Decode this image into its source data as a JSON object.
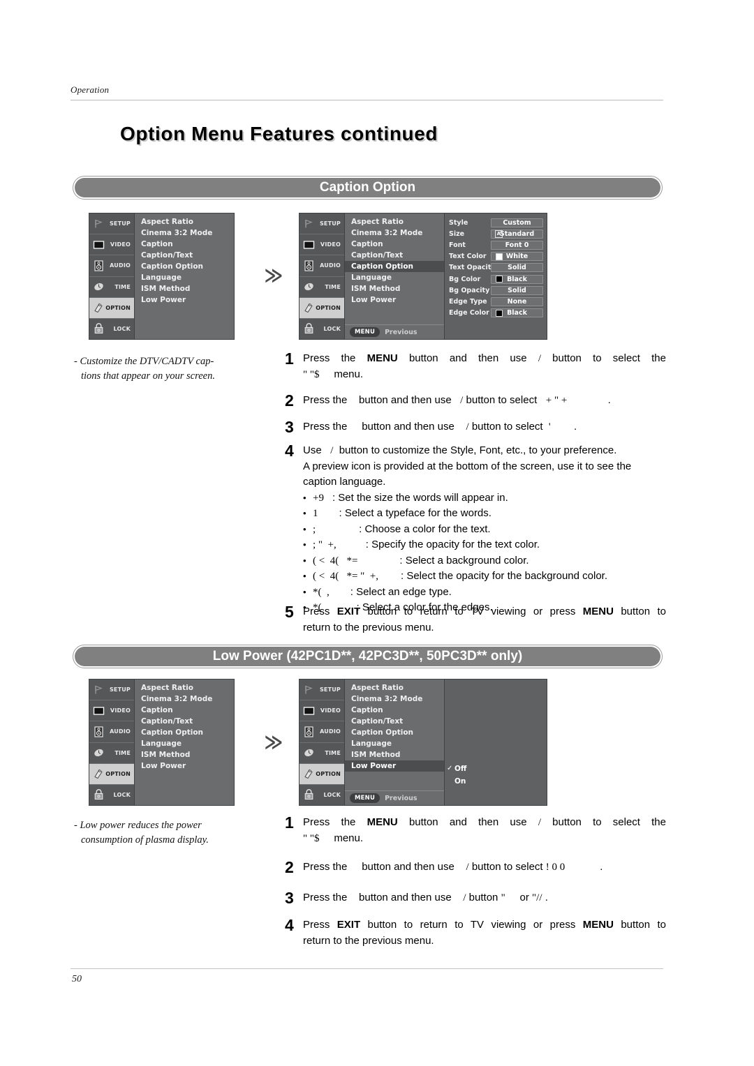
{
  "header": {
    "running_head": "Operation",
    "title": "Option Menu Features continued"
  },
  "sections": [
    {
      "id": "caption",
      "pill_label": "Caption Option"
    },
    {
      "id": "lowpower",
      "pill_label": "Low Power (42PC1D**, 42PC3D**, 50PC3D** only)"
    }
  ],
  "osd": {
    "sidebar": [
      {
        "label": "SETUP",
        "icon": "flag-icon",
        "active": false
      },
      {
        "label": "VIDEO",
        "icon": "screen-icon",
        "active": false
      },
      {
        "label": "AUDIO",
        "icon": "speaker-icon",
        "active": false
      },
      {
        "label": "TIME",
        "icon": "clock-icon",
        "active": false
      },
      {
        "label": "OPTION",
        "icon": "tag-icon",
        "active": true
      },
      {
        "label": "LOCK",
        "icon": "padlock-icon",
        "active": false
      }
    ],
    "menu_items": [
      "Aspect Ratio",
      "Cinema 3:2 Mode",
      "Caption",
      "Caption/Text",
      "Caption Option",
      "Language",
      "ISM Method",
      "Low Power"
    ],
    "selected_caption_option": "Caption Option",
    "selected_low_power": "Low Power",
    "footer": {
      "menu_chip": "MENU",
      "previous_label": "Previous"
    },
    "caption_detail": [
      {
        "label": "Style",
        "value": "Custom",
        "marker": "none"
      },
      {
        "label": "Size",
        "value": "Standard",
        "marker": "sizeA"
      },
      {
        "label": "Font",
        "value": "Font  0",
        "marker": "none"
      },
      {
        "label": "Text Color",
        "value": "White",
        "marker": "swatch",
        "swatch": "#ffffff"
      },
      {
        "label": "Text Opacity",
        "value": "Solid",
        "marker": "none"
      },
      {
        "label": "Bg Color",
        "value": "Black",
        "marker": "swatch",
        "swatch": "#000000"
      },
      {
        "label": "Bg Opacity",
        "value": "Solid",
        "marker": "none"
      },
      {
        "label": "Edge Type",
        "value": "None",
        "marker": "none"
      },
      {
        "label": "Edge Color",
        "value": "Black",
        "marker": "swatch",
        "swatch": "#000000"
      }
    ],
    "size_glyph": "A",
    "low_power_options": [
      {
        "label": "Off",
        "checked": true,
        "check": "✓"
      },
      {
        "label": "On",
        "checked": false,
        "check": ""
      }
    ],
    "arrow_glyph": "≫"
  },
  "caption_section": {
    "note_line1": "- Customize the DTV/CADTV cap-",
    "note_line2": "tions that appear on your screen.",
    "steps": [
      {
        "num": "1",
        "line1_a": "Press  the ",
        "line1_bold": "MENU",
        "line1_b": " button  and  then  use ",
        "line1_glyph": "/",
        "line1_c": " button  to  select  the",
        "line2_glyph": "\" \"$",
        "line2_b": "menu."
      },
      {
        "num": "2",
        "text_a": "Press the ",
        "glyph_1": "",
        "text_b": "button and then use ",
        "glyph_2": "/",
        "text_c": " button to select ",
        "glyph_3": "+  \" +",
        "text_d": "."
      },
      {
        "num": "3",
        "text_a": "Press the ",
        "glyph_1": "",
        "text_b": "button and then use ",
        "glyph_2": "/",
        "text_c": " button to select ",
        "glyph_3": "'",
        "text_d": "."
      },
      {
        "num": "4",
        "line1_a": "Use ",
        "line1_glyph": "/",
        "line1_b": " button to customize the Style, Font, etc., to your preference.",
        "line2": "A preview icon is provided at the bottom of the screen, use it to see the",
        "line3": "caption language.",
        "bullets": [
          {
            "tag": "+9",
            "desc": ": Set the size the words will appear in."
          },
          {
            "tag": "1",
            "desc": ": Select a typeface for the words."
          },
          {
            "tag": ";",
            "desc": ": Choose a color for the text."
          },
          {
            "tag": "; \"  +,",
            "desc": ": Specify the opacity for the text color."
          },
          {
            "tag": "( <  4(   *=",
            "desc": ": Select a background color."
          },
          {
            "tag": "( <  4(   *= \"  +,",
            "desc": ": Select the opacity for the background color."
          },
          {
            "tag": "*(  ,",
            "desc": ": Select an edge type."
          },
          {
            "tag": "*(",
            "desc": ": Select a color for the edges."
          }
        ]
      },
      {
        "num": "5",
        "line1_a": "Press ",
        "line1_bold1": "EXIT",
        "line1_b": " button to return to TV viewing or press ",
        "line1_bold2": "MENU",
        "line1_c": " button to",
        "line2": "return to the previous menu."
      }
    ]
  },
  "lowpower_section": {
    "note_line1": "- Low power reduces the power",
    "note_line2": "consumption of plasma display.",
    "steps": [
      {
        "num": "1",
        "line1_a": "Press  the ",
        "line1_bold": "MENU",
        "line1_b": " button  and  then  use ",
        "line1_glyph": "/",
        "line1_c": " button  to  select  the",
        "line2_glyph": "\" \"$",
        "line2_b": "menu."
      },
      {
        "num": "2",
        "text_a": "Press the ",
        "text_b": "button and then use ",
        "glyph_2": "/",
        "text_c": " button to select ",
        "glyph_3": "! 0   0",
        "text_d": "."
      },
      {
        "num": "3",
        "text_a": "Press the ",
        "text_b": "button and then use ",
        "glyph_2": "/",
        "text_c": " button ",
        "glyph_3": "\"",
        "text_or": " or ",
        "glyph_4": "\"//",
        "text_d": "."
      },
      {
        "num": "4",
        "line1_a": "Press ",
        "line1_bold1": "EXIT",
        "line1_b": " button to return to TV viewing or press ",
        "line1_bold2": "MENU",
        "line1_c": " button to",
        "line2": "return to the previous menu."
      }
    ]
  },
  "footer": {
    "page_number": "50"
  }
}
